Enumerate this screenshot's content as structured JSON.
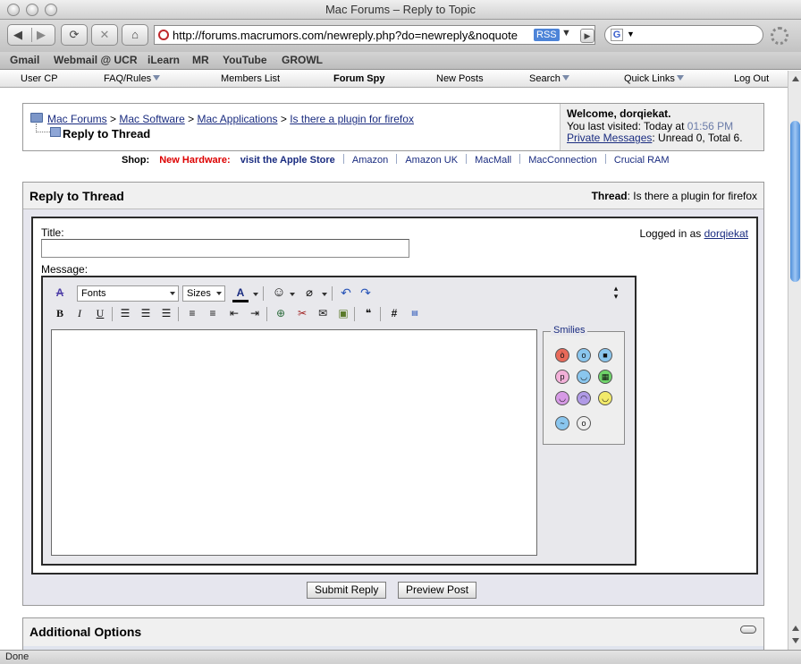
{
  "window": {
    "title": "Mac Forums – Reply to Topic",
    "url": "http://forums.macrumors.com/newreply.php?do=newreply&noquote",
    "rss_label": "RSS",
    "search_engine_letter": "G",
    "status": "Done"
  },
  "bookmarks": [
    "Gmail",
    "Webmail @ UCR",
    "iLearn",
    "MR",
    "YouTube",
    "GROWL"
  ],
  "navbar": {
    "items": [
      "User CP",
      "FAQ/Rules",
      "Members List",
      "Forum Spy",
      "New Posts",
      "Search",
      "Quick Links",
      "Log Out"
    ]
  },
  "breadcrumb": {
    "items": [
      "Mac Forums",
      "Mac Software",
      "Mac Applications",
      "Is there a plugin for firefox"
    ],
    "separator": ">",
    "current": "Reply to Thread"
  },
  "welcome": {
    "greeting": "Welcome, dorqiekat.",
    "last_visited_prefix": "You last visited: Today at",
    "last_visited_time": "01:56 PM",
    "pm_link": "Private Messages",
    "pm_status": ": Unread 0, Total 6."
  },
  "shop": {
    "label": "Shop:",
    "new_hardware": "New Hardware:",
    "apple_store": "visit the Apple Store",
    "links": [
      "Amazon",
      "Amazon UK",
      "MacMall",
      "MacConnection",
      "Crucial RAM"
    ]
  },
  "reply": {
    "heading": "Reply to Thread",
    "thread_label": "Thread",
    "thread_name": ": Is there a plugin for firefox",
    "title_label": "Title:",
    "title_value": "",
    "message_label": "Message:",
    "logged_in_prefix": "Logged in as",
    "username": "dorqiekat",
    "fonts_label": "Fonts",
    "sizes_label": "Sizes",
    "smilies_label": "Smilies",
    "submit_label": "Submit Reply",
    "preview_label": "Preview Post"
  },
  "additional_options": {
    "heading": "Additional Options"
  },
  "colors": {
    "link": "#1a2c80",
    "new_hardware": "#dd0000",
    "time": "#6a7ba8",
    "panel_bg": "#e6e6ee"
  }
}
